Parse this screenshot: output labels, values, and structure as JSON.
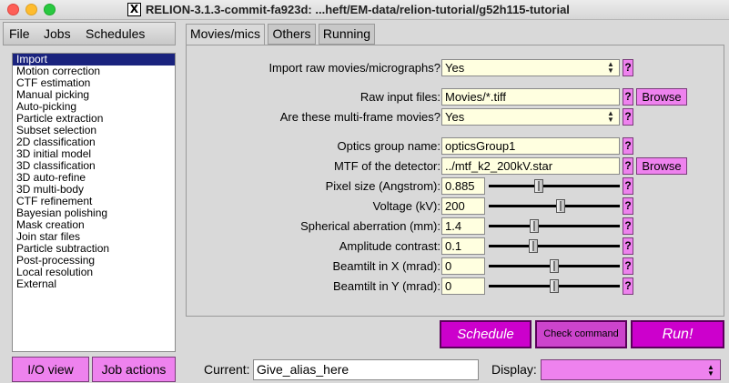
{
  "window": {
    "title": "RELION-3.1.3-commit-fa923d: ...heft/EM-data/relion-tutorial/g52h115-tutorial",
    "x_logo": "X"
  },
  "menu": [
    "File",
    "Jobs",
    "Schedules"
  ],
  "jobs": {
    "selected": "Import",
    "items": [
      "Import",
      "Motion correction",
      "CTF estimation",
      "Manual picking",
      "Auto-picking",
      "Particle extraction",
      "Subset selection",
      "2D classification",
      "3D initial model",
      "3D classification",
      "3D auto-refine",
      "3D multi-body",
      "CTF refinement",
      "Bayesian polishing",
      "Mask creation",
      "Join star files",
      "Particle subtraction",
      "Post-processing",
      "Local resolution",
      "External"
    ]
  },
  "left_buttons": {
    "io_view": "I/O view",
    "job_actions": "Job actions"
  },
  "tabs": [
    "Movies/mics",
    "Others",
    "Running"
  ],
  "active_tab": "Movies/mics",
  "form": {
    "import_raw": {
      "label": "Import raw movies/micrographs?",
      "value": "Yes"
    },
    "raw_input": {
      "label": "Raw input files:",
      "value": "Movies/*.tiff"
    },
    "multi_frame": {
      "label": "Are these multi-frame movies?",
      "value": "Yes"
    },
    "optics_group": {
      "label": "Optics group name:",
      "value": "opticsGroup1"
    },
    "mtf": {
      "label": "MTF of the detector:",
      "value": "../mtf_k2_200kV.star"
    },
    "pixel_size": {
      "label": "Pixel size (Angstrom):",
      "value": "0.885",
      "slider": 0.38
    },
    "voltage": {
      "label": "Voltage (kV):",
      "value": "200",
      "slider": 0.55
    },
    "cs": {
      "label": "Spherical aberration (mm):",
      "value": "1.4",
      "slider": 0.35
    },
    "amp_contrast": {
      "label": "Amplitude contrast:",
      "value": "0.1",
      "slider": 0.34
    },
    "beamtilt_x": {
      "label": "Beamtilt in X (mrad):",
      "value": "0",
      "slider": 0.5
    },
    "beamtilt_y": {
      "label": "Beamtilt in Y (mrad):",
      "value": "0",
      "slider": 0.5
    }
  },
  "help_label": "?",
  "browse_label": "Browse",
  "actions": {
    "schedule": "Schedule",
    "check": "Check command",
    "run": "Run!"
  },
  "footer": {
    "current_label": "Current:",
    "current_value": "Give_alias_here",
    "display_label": "Display:",
    "display_value": ""
  },
  "colors": {
    "accent": "#ee82ee",
    "action": "#cc00cc",
    "field": "#ffffe0",
    "selection": "#1a237e"
  }
}
